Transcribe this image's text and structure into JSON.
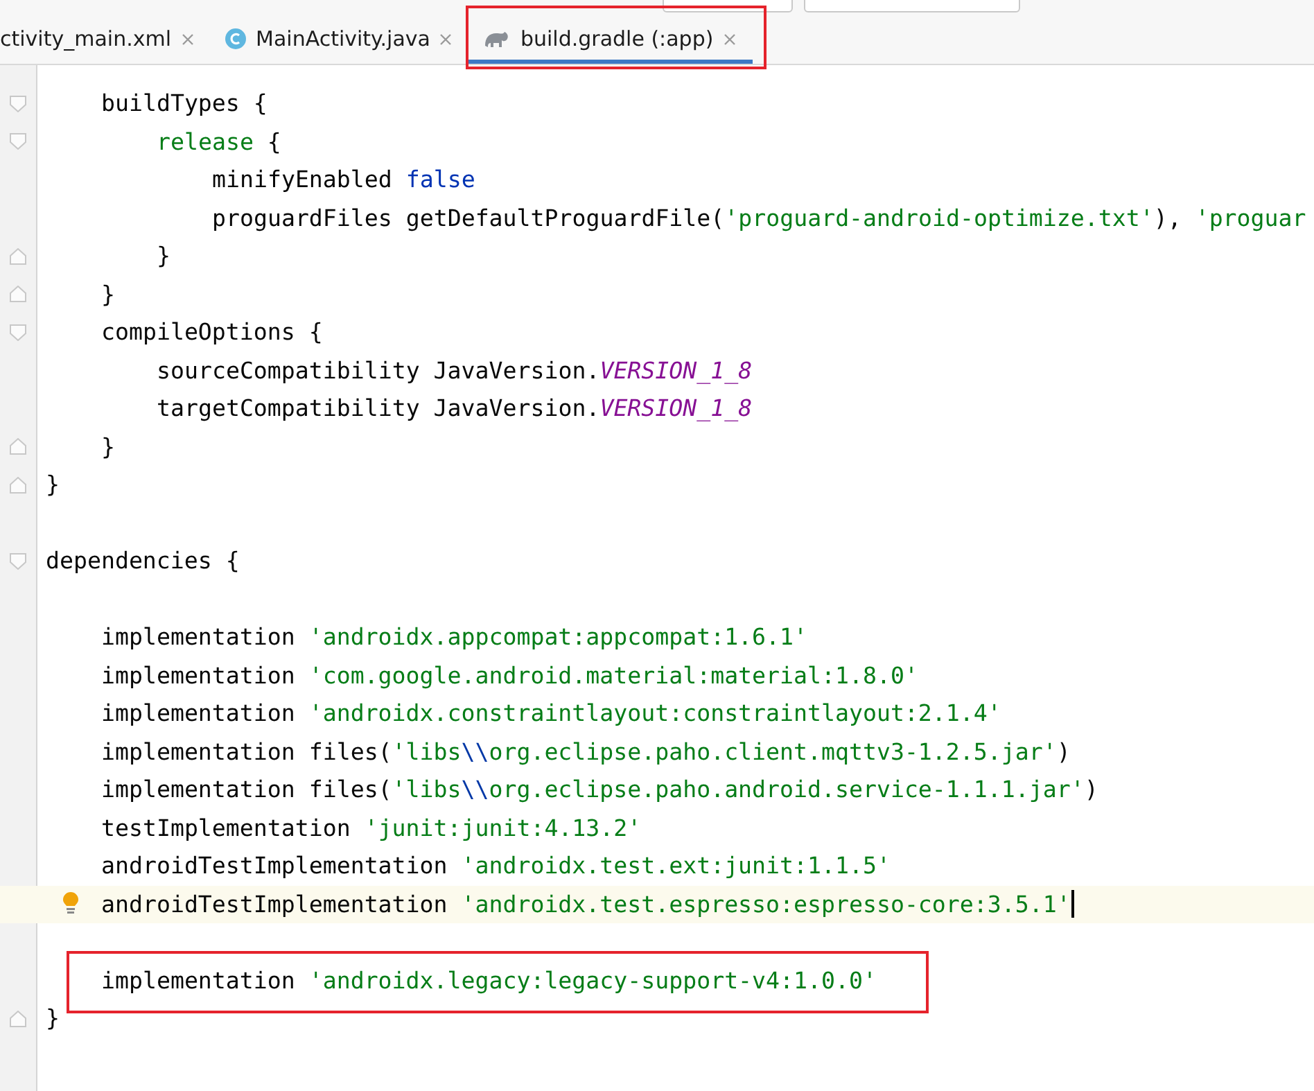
{
  "tabs": [
    {
      "label": "ctivity_main.xml",
      "kind": "plain",
      "selected": false,
      "annotated": false
    },
    {
      "label": "MainActivity.java",
      "kind": "class",
      "selected": false,
      "annotated": false
    },
    {
      "label": "build.gradle (:app)",
      "kind": "gradle",
      "selected": true,
      "annotated": true
    }
  ],
  "editor": {
    "lines": [
      {
        "kind": "group",
        "children": [
          {
            "kind": "open",
            "segments": [
              {
                "kind": "plain",
                "text": "buildTypes {"
              }
            ],
            "children": [
              {
                "kind": "open",
                "segments": [
                  {
                    "kind": "keyword",
                    "text": "release"
                  },
                  {
                    "kind": "plain",
                    "text": " {"
                  }
                ],
                "children": [
                  {
                    "kind": "code",
                    "segments": [
                      {
                        "kind": "plain",
                        "text": "minifyEnabled "
                      },
                      {
                        "kind": "literal",
                        "text": "false"
                      }
                    ]
                  },
                  {
                    "kind": "code",
                    "segments": [
                      {
                        "kind": "plain",
                        "text": "proguardFiles getDefaultProguardFile("
                      },
                      {
                        "kind": "string",
                        "text": "'proguard-android-optimize.txt'"
                      },
                      {
                        "kind": "plain",
                        "text": "), "
                      },
                      {
                        "kind": "string",
                        "text": "'proguar"
                      }
                    ]
                  }
                ]
              },
              {
                "kind": "close",
                "segments": [
                  {
                    "kind": "plain",
                    "text": "}"
                  }
                ]
              }
            ]
          },
          {
            "kind": "close",
            "segments": [
              {
                "kind": "plain",
                "text": "}"
              }
            ]
          },
          {
            "kind": "open",
            "segments": [
              {
                "kind": "plain",
                "text": "compileOptions {"
              }
            ],
            "children": [
              {
                "kind": "code",
                "segments": [
                  {
                    "kind": "plain",
                    "text": "sourceCompatibility JavaVersion."
                  },
                  {
                    "kind": "constant",
                    "text": "VERSION_1_8"
                  }
                ]
              },
              {
                "kind": "code",
                "segments": [
                  {
                    "kind": "plain",
                    "text": "targetCompatibility JavaVersion."
                  },
                  {
                    "kind": "constant",
                    "text": "VERSION_1_8"
                  }
                ]
              }
            ]
          },
          {
            "kind": "close",
            "segments": [
              {
                "kind": "plain",
                "text": "}"
              }
            ]
          }
        ]
      },
      {
        "kind": "close",
        "segments": [
          {
            "kind": "plain",
            "text": "}"
          }
        ]
      },
      {
        "kind": "blank"
      },
      {
        "kind": "open",
        "segments": [
          {
            "kind": "plain",
            "text": "dependencies {"
          }
        ],
        "children": [
          {
            "kind": "blank"
          },
          {
            "kind": "code",
            "segments": [
              {
                "kind": "plain",
                "text": "implementation "
              },
              {
                "kind": "string",
                "text": "'androidx.appcompat:appcompat:1.6.1'"
              }
            ]
          },
          {
            "kind": "code",
            "segments": [
              {
                "kind": "plain",
                "text": "implementation "
              },
              {
                "kind": "string",
                "text": "'com.google.android.material:material:1.8.0'"
              }
            ]
          },
          {
            "kind": "code",
            "segments": [
              {
                "kind": "plain",
                "text": "implementation "
              },
              {
                "kind": "string",
                "text": "'androidx.constraintlayout:constraintlayout:2.1.4'"
              }
            ]
          },
          {
            "kind": "code",
            "segments": [
              {
                "kind": "plain",
                "text": "implementation files("
              },
              {
                "kind": "string",
                "text": "'libs"
              },
              {
                "kind": "escape",
                "text": "\\\\"
              },
              {
                "kind": "string",
                "text": "org.eclipse.paho.client.mqttv3-1.2.5.jar'"
              },
              {
                "kind": "plain",
                "text": ")"
              }
            ]
          },
          {
            "kind": "code",
            "segments": [
              {
                "kind": "plain",
                "text": "implementation files("
              },
              {
                "kind": "string",
                "text": "'libs"
              },
              {
                "kind": "escape",
                "text": "\\\\"
              },
              {
                "kind": "string",
                "text": "org.eclipse.paho.android.service-1.1.1.jar'"
              },
              {
                "kind": "plain",
                "text": ")"
              }
            ]
          },
          {
            "kind": "code",
            "segments": [
              {
                "kind": "plain",
                "text": "testImplementation "
              },
              {
                "kind": "string",
                "text": "'junit:junit:4.13.2'"
              }
            ]
          },
          {
            "kind": "code",
            "segments": [
              {
                "kind": "plain",
                "text": "androidTestImplementation "
              },
              {
                "kind": "string",
                "text": "'androidx.test.ext:junit:1.1.5'"
              }
            ]
          },
          {
            "kind": "code",
            "current": true,
            "hint": true,
            "segments": [
              {
                "kind": "plain",
                "text": "androidTestImplementation "
              },
              {
                "kind": "string",
                "text": "'androidx.test.espresso:espresso-core:3.5.1'"
              }
            ]
          },
          {
            "kind": "blank"
          },
          {
            "kind": "code",
            "annotated": true,
            "segments": [
              {
                "kind": "plain",
                "text": "implementation "
              },
              {
                "kind": "string",
                "text": "'androidx.legacy:legacy-support-v4:1.0.0'"
              }
            ]
          }
        ]
      },
      {
        "kind": "close",
        "segments": [
          {
            "kind": "plain",
            "text": "}"
          }
        ]
      }
    ]
  }
}
